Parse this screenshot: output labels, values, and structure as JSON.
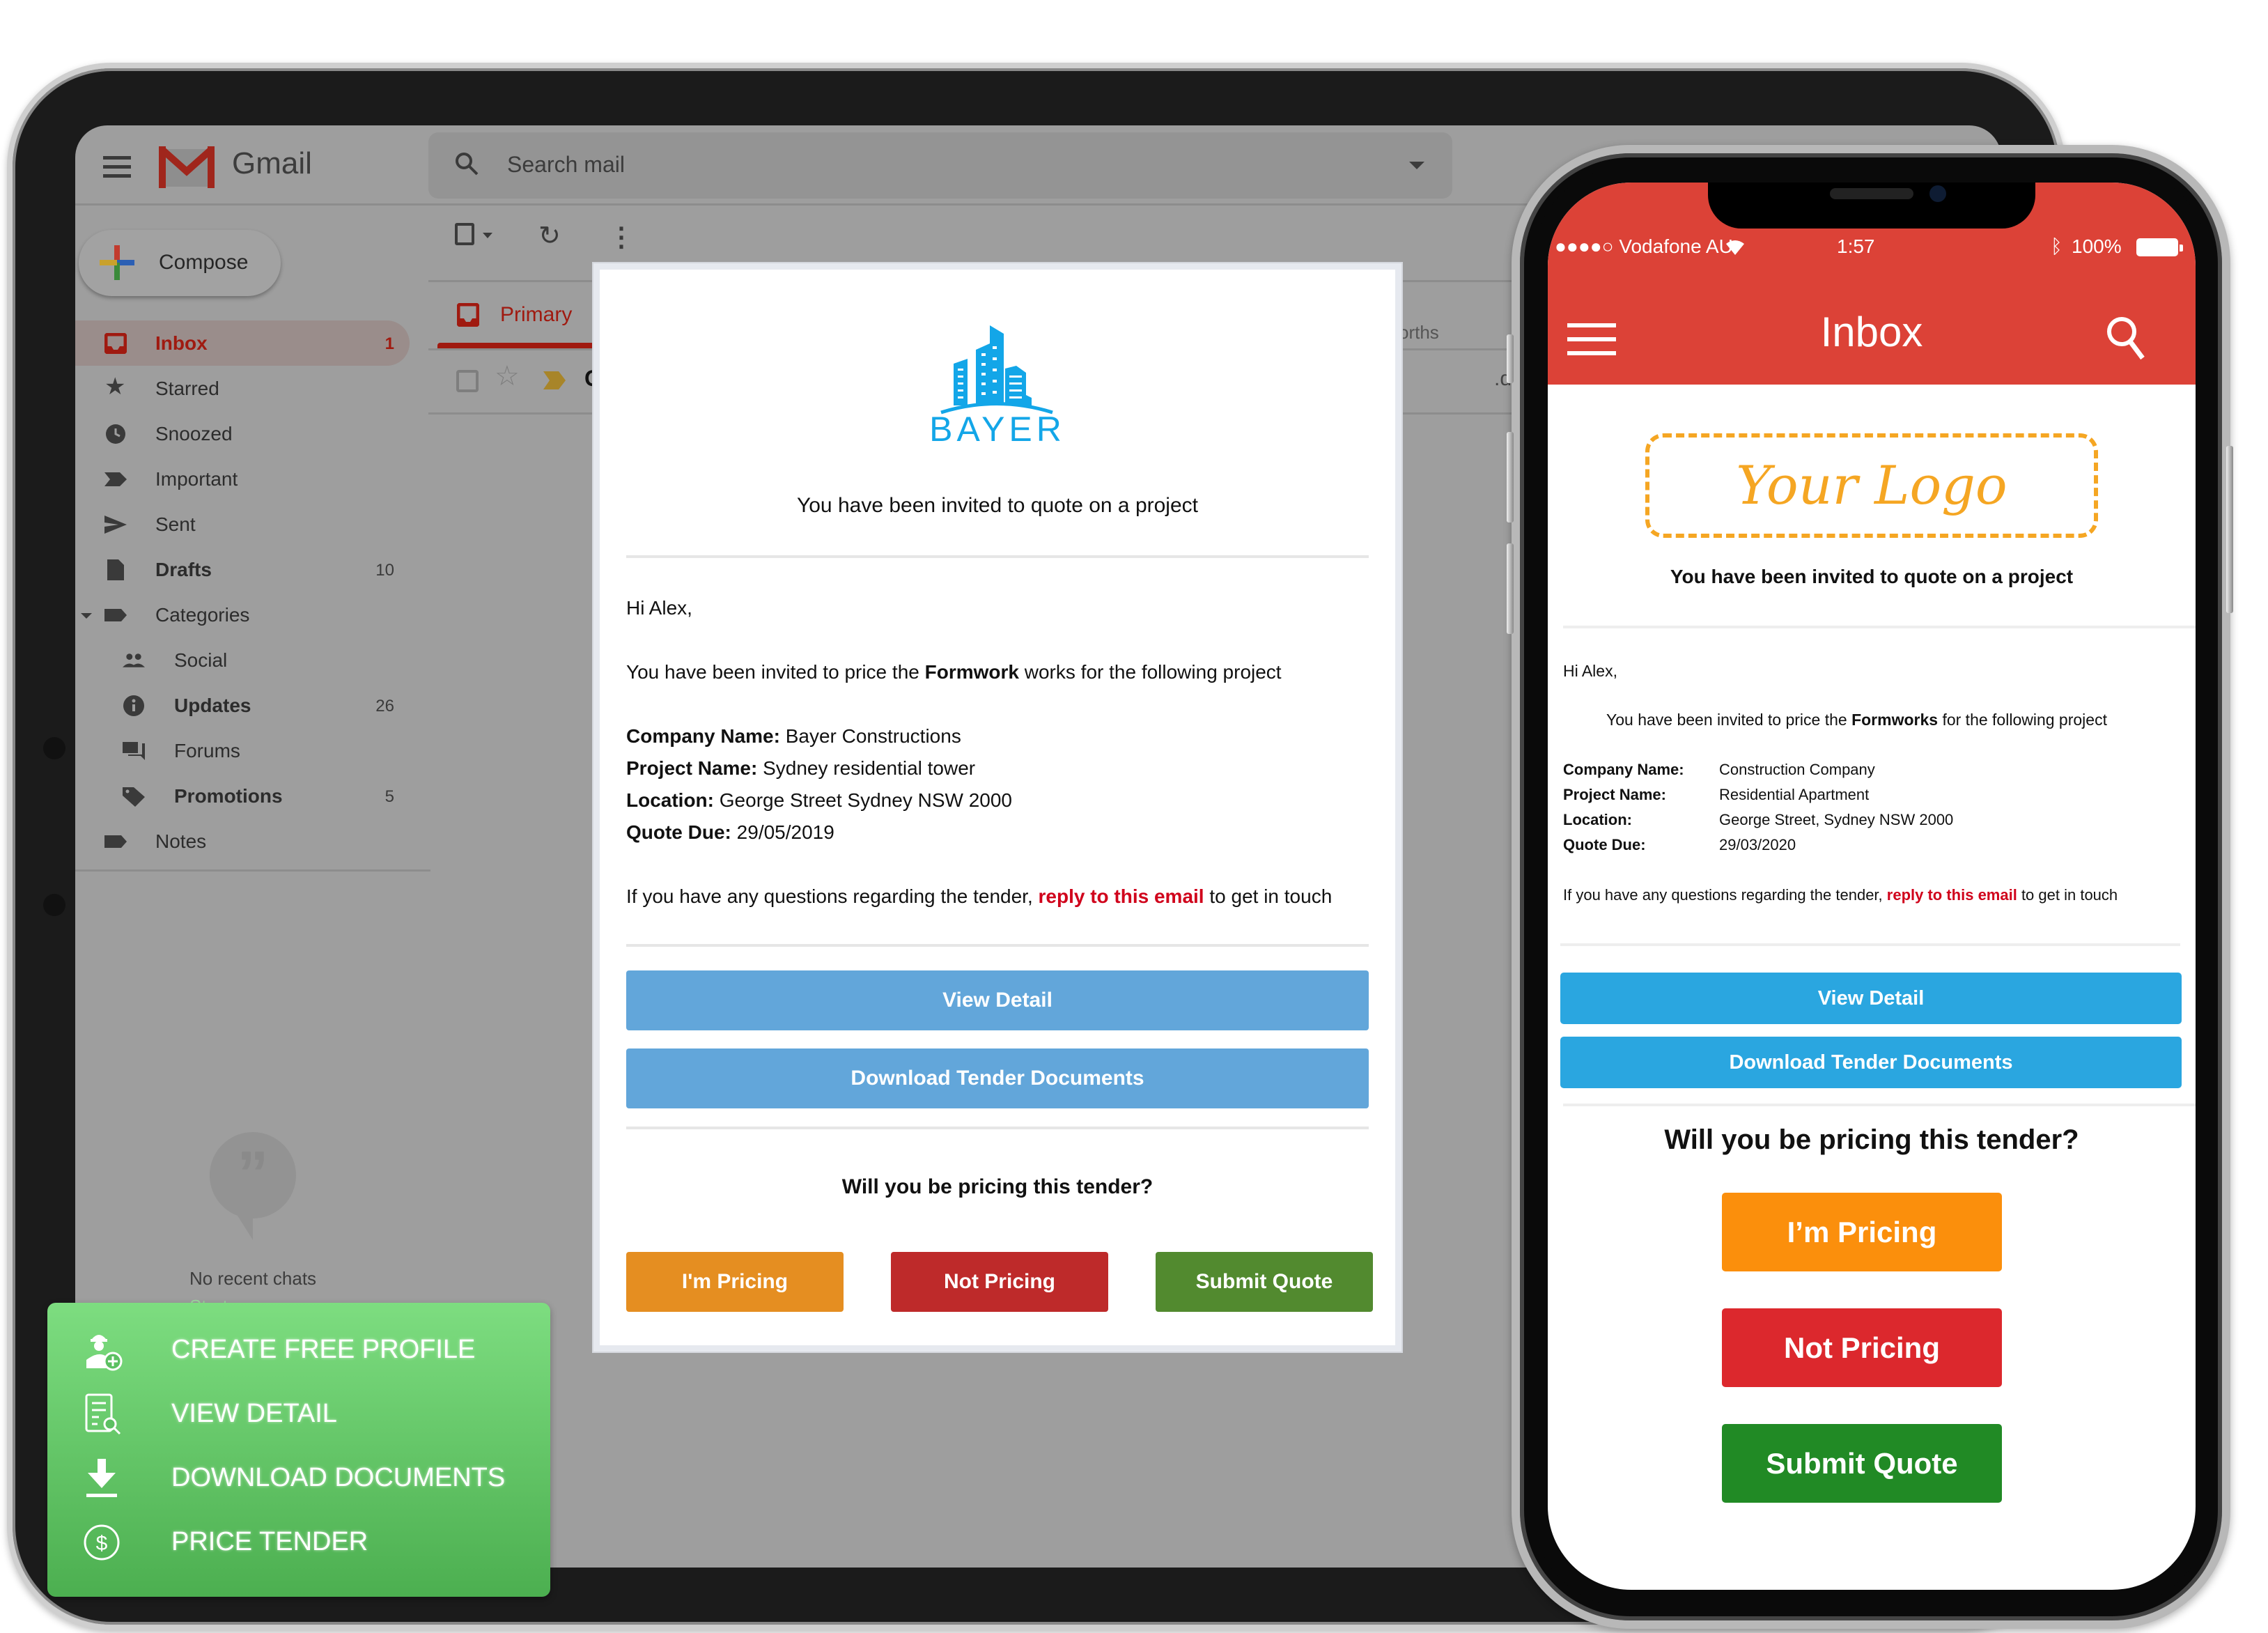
{
  "gmail": {
    "app_name": "Gmail",
    "search_placeholder": "Search mail",
    "compose_label": "Compose",
    "nav": [
      {
        "label": "Inbox",
        "count": "1",
        "icon": "inbox-icon"
      },
      {
        "label": "Starred",
        "count": "",
        "icon": "star-icon"
      },
      {
        "label": "Snoozed",
        "count": "",
        "icon": "clock-icon"
      },
      {
        "label": "Important",
        "count": "",
        "icon": "important-icon"
      },
      {
        "label": "Sent",
        "count": "",
        "icon": "send-icon"
      },
      {
        "label": "Drafts",
        "count": "10",
        "icon": "draft-icon"
      },
      {
        "label": "Categories",
        "count": "",
        "icon": "label-icon"
      },
      {
        "label": "Social",
        "count": "",
        "icon": "people-icon"
      },
      {
        "label": "Updates",
        "count": "26",
        "icon": "info-icon"
      },
      {
        "label": "Forums",
        "count": "",
        "icon": "forum-icon"
      },
      {
        "label": "Promotions",
        "count": "5",
        "icon": "tag-icon"
      },
      {
        "label": "Notes",
        "count": "",
        "icon": "label-icon"
      }
    ],
    "tab_primary": "Primary",
    "tab_partial": "orths",
    "row_sender_partial": "G",
    "row_ext_partial": ".de",
    "no_chats": "No recent chats",
    "start_new": "Start a new one"
  },
  "desktop_email": {
    "brand": "BAYER",
    "headline": "You have been invited to quote on a project",
    "greeting": "Hi Alex,",
    "intro_before": "You have been invited to price the ",
    "intro_bold": "Formwork",
    "intro_after": " works for the following project",
    "details": [
      {
        "label": "Company Name:",
        "value": "Bayer Constructions"
      },
      {
        "label": "Project Name:",
        "value": "Sydney residential tower"
      },
      {
        "label": "Location:",
        "value": "George Street Sydney NSW 2000"
      },
      {
        "label": "Quote Due:",
        "value": "29/05/2019"
      }
    ],
    "contact_before": "If you have any questions regarding the tender, ",
    "contact_link": "reply to this email",
    "contact_after": " to get in touch",
    "view_detail": "View Detail",
    "download_docs": "Download Tender Documents",
    "question": "Will you be pricing this tender?",
    "actions": [
      {
        "label": "I'm Pricing",
        "color": "#e58e21"
      },
      {
        "label": "Not Pricing",
        "color": "#be2a2a"
      },
      {
        "label": "Submit Quote",
        "color": "#528a2f"
      }
    ]
  },
  "features": [
    {
      "label": "CREATE FREE PROFILE",
      "icon": "worker-add-icon"
    },
    {
      "label": "VIEW DETAIL",
      "icon": "document-search-icon"
    },
    {
      "label": "DOWNLOAD DOCUMENTS",
      "icon": "download-icon"
    },
    {
      "label": "PRICE TENDER",
      "icon": "dollar-circle-icon"
    }
  ],
  "phone": {
    "carrier": "●●●●○ Vodafone AU",
    "time": "1:57",
    "battery": "100%",
    "title": "Inbox",
    "logo_placeholder": "Your Logo",
    "headline": "You have been invited to quote on a project",
    "greeting": "Hi Alex,",
    "intro_before": "You have been invited to price the ",
    "intro_bold": "Formworks",
    "intro_after": " for the following project",
    "details": [
      {
        "label": "Company Name:",
        "value": "Construction Company"
      },
      {
        "label": "Project Name:",
        "value": "Residential Apartment"
      },
      {
        "label": "Location:",
        "value": "George Street, Sydney NSW 2000"
      },
      {
        "label": "Quote Due:",
        "value": "29/03/2020"
      }
    ],
    "contact_before": "If you have any questions regarding the tender, ",
    "contact_link": "reply to this email",
    "contact_after": " to get in touch",
    "view_detail": "View Detail",
    "download_docs": "Download Tender Documents",
    "question": "Will you be pricing this tender?",
    "actions": [
      {
        "label": "I’m Pricing",
        "color": "#fb8f0c"
      },
      {
        "label": "Not Pricing",
        "color": "#dc282d"
      },
      {
        "label": "Submit Quote",
        "color": "#218a25"
      }
    ]
  },
  "colors": {
    "gmail_red": "#a01a10",
    "phone_header": "#dc4237",
    "brand_blue": "#13a6e8",
    "link_red": "#d0021b",
    "feature_green": "#5cc062",
    "logo_orange": "#f5a623"
  }
}
